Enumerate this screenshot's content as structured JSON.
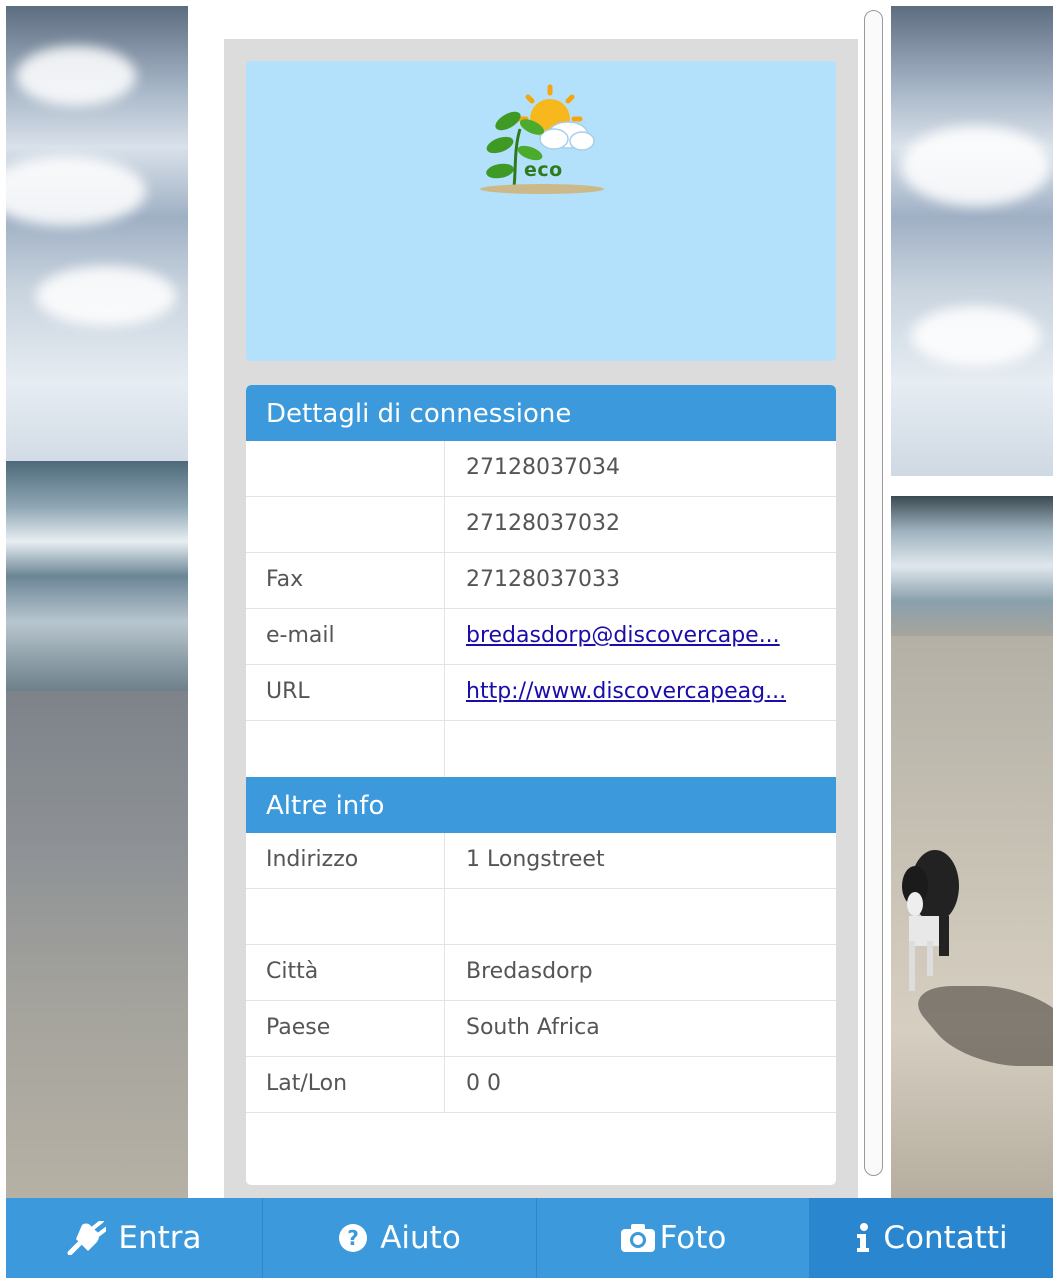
{
  "logo": {
    "text": "eco"
  },
  "sections": {
    "connection": {
      "title": "Dettagli di connessione",
      "rows": [
        {
          "label": "",
          "value": "27128037034"
        },
        {
          "label": "",
          "value": "27128037032"
        },
        {
          "label": "Fax",
          "value": "27128037033"
        },
        {
          "label": "e-mail",
          "value": "bredasdorp@discovercape..."
        },
        {
          "label": "URL",
          "value": "http://www.discovercapeag..."
        },
        {
          "label": "",
          "value": ""
        }
      ]
    },
    "other": {
      "title": "Altre info",
      "rows": [
        {
          "label": "Indirizzo",
          "value": "1 Longstreet"
        },
        {
          "label": "",
          "value": ""
        },
        {
          "label": "Città",
          "value": "Bredasdorp"
        },
        {
          "label": "Paese",
          "value": "South Africa"
        },
        {
          "label": "Lat/Lon",
          "value": "0 0"
        }
      ]
    }
  },
  "nav": [
    {
      "label": "Entra",
      "icon": "plug-icon"
    },
    {
      "label": "Aiuto",
      "icon": "question-circle-icon"
    },
    {
      "label": "Foto",
      "icon": "camera-icon"
    },
    {
      "label": "Contatti",
      "icon": "info-icon"
    }
  ],
  "colors": {
    "accent": "#3b99dc",
    "logo_bg": "#b3e0fb",
    "link": "#1a0dab"
  }
}
